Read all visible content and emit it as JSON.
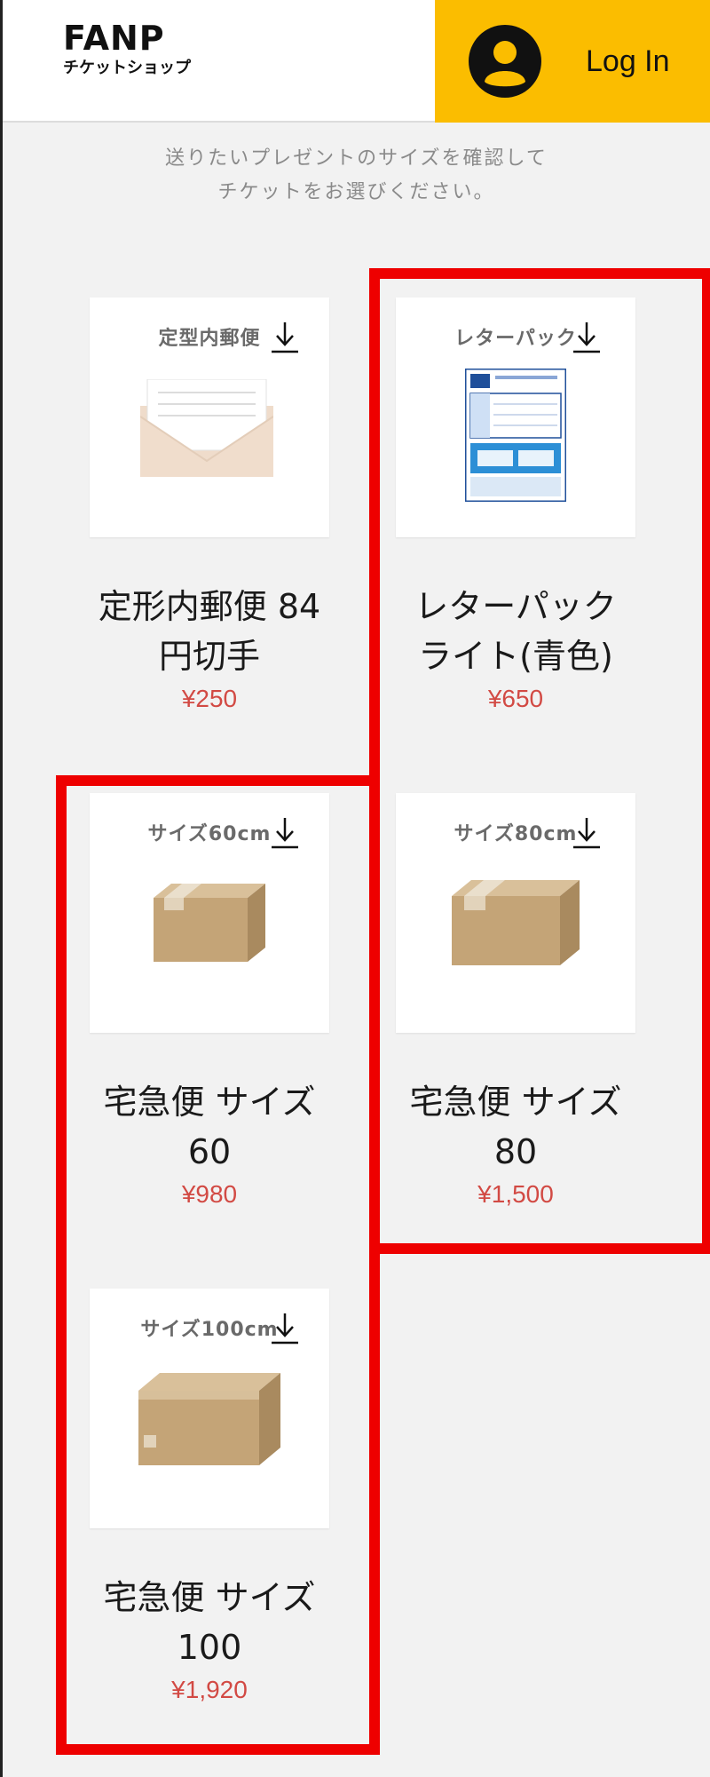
{
  "header": {
    "logo_main": "FANP",
    "logo_sub": "チケットショップ",
    "login_label": "Log In",
    "login_icon": "user-avatar-icon",
    "header_bg": "#ffffff",
    "login_bg": "#fbbd00"
  },
  "intro": {
    "line1": "送りたいプレゼントのサイズを確認して",
    "line2": "チケットをお選びください。"
  },
  "download_icon": "download-arrow-icon",
  "products": [
    {
      "thumb_label": "定型内郵便",
      "name_line1": "定形内郵便 84",
      "name_line2": "円切手",
      "price": "¥250",
      "image": "envelope"
    },
    {
      "thumb_label": "レターパック",
      "name_line1": "レターパック",
      "name_line2": "ライト(青色)",
      "price": "¥650",
      "image": "letterpack-light"
    },
    {
      "thumb_label": "サイズ60cm",
      "name_line1": "宅急便 サイズ",
      "name_line2": "60",
      "price": "¥980",
      "image": "box-small"
    },
    {
      "thumb_label": "サイズ80cm",
      "name_line1": "宅急便 サイズ",
      "name_line2": "80",
      "price": "¥1,500",
      "image": "box-medium"
    },
    {
      "thumb_label": "サイズ100cm",
      "name_line1": "宅急便 サイズ",
      "name_line2": "100",
      "price": "¥1,920",
      "image": "box-large"
    }
  ],
  "colors": {
    "page_bg": "#f2f2f2",
    "price": "#d24a44",
    "highlight_outline": "#ee0000"
  }
}
